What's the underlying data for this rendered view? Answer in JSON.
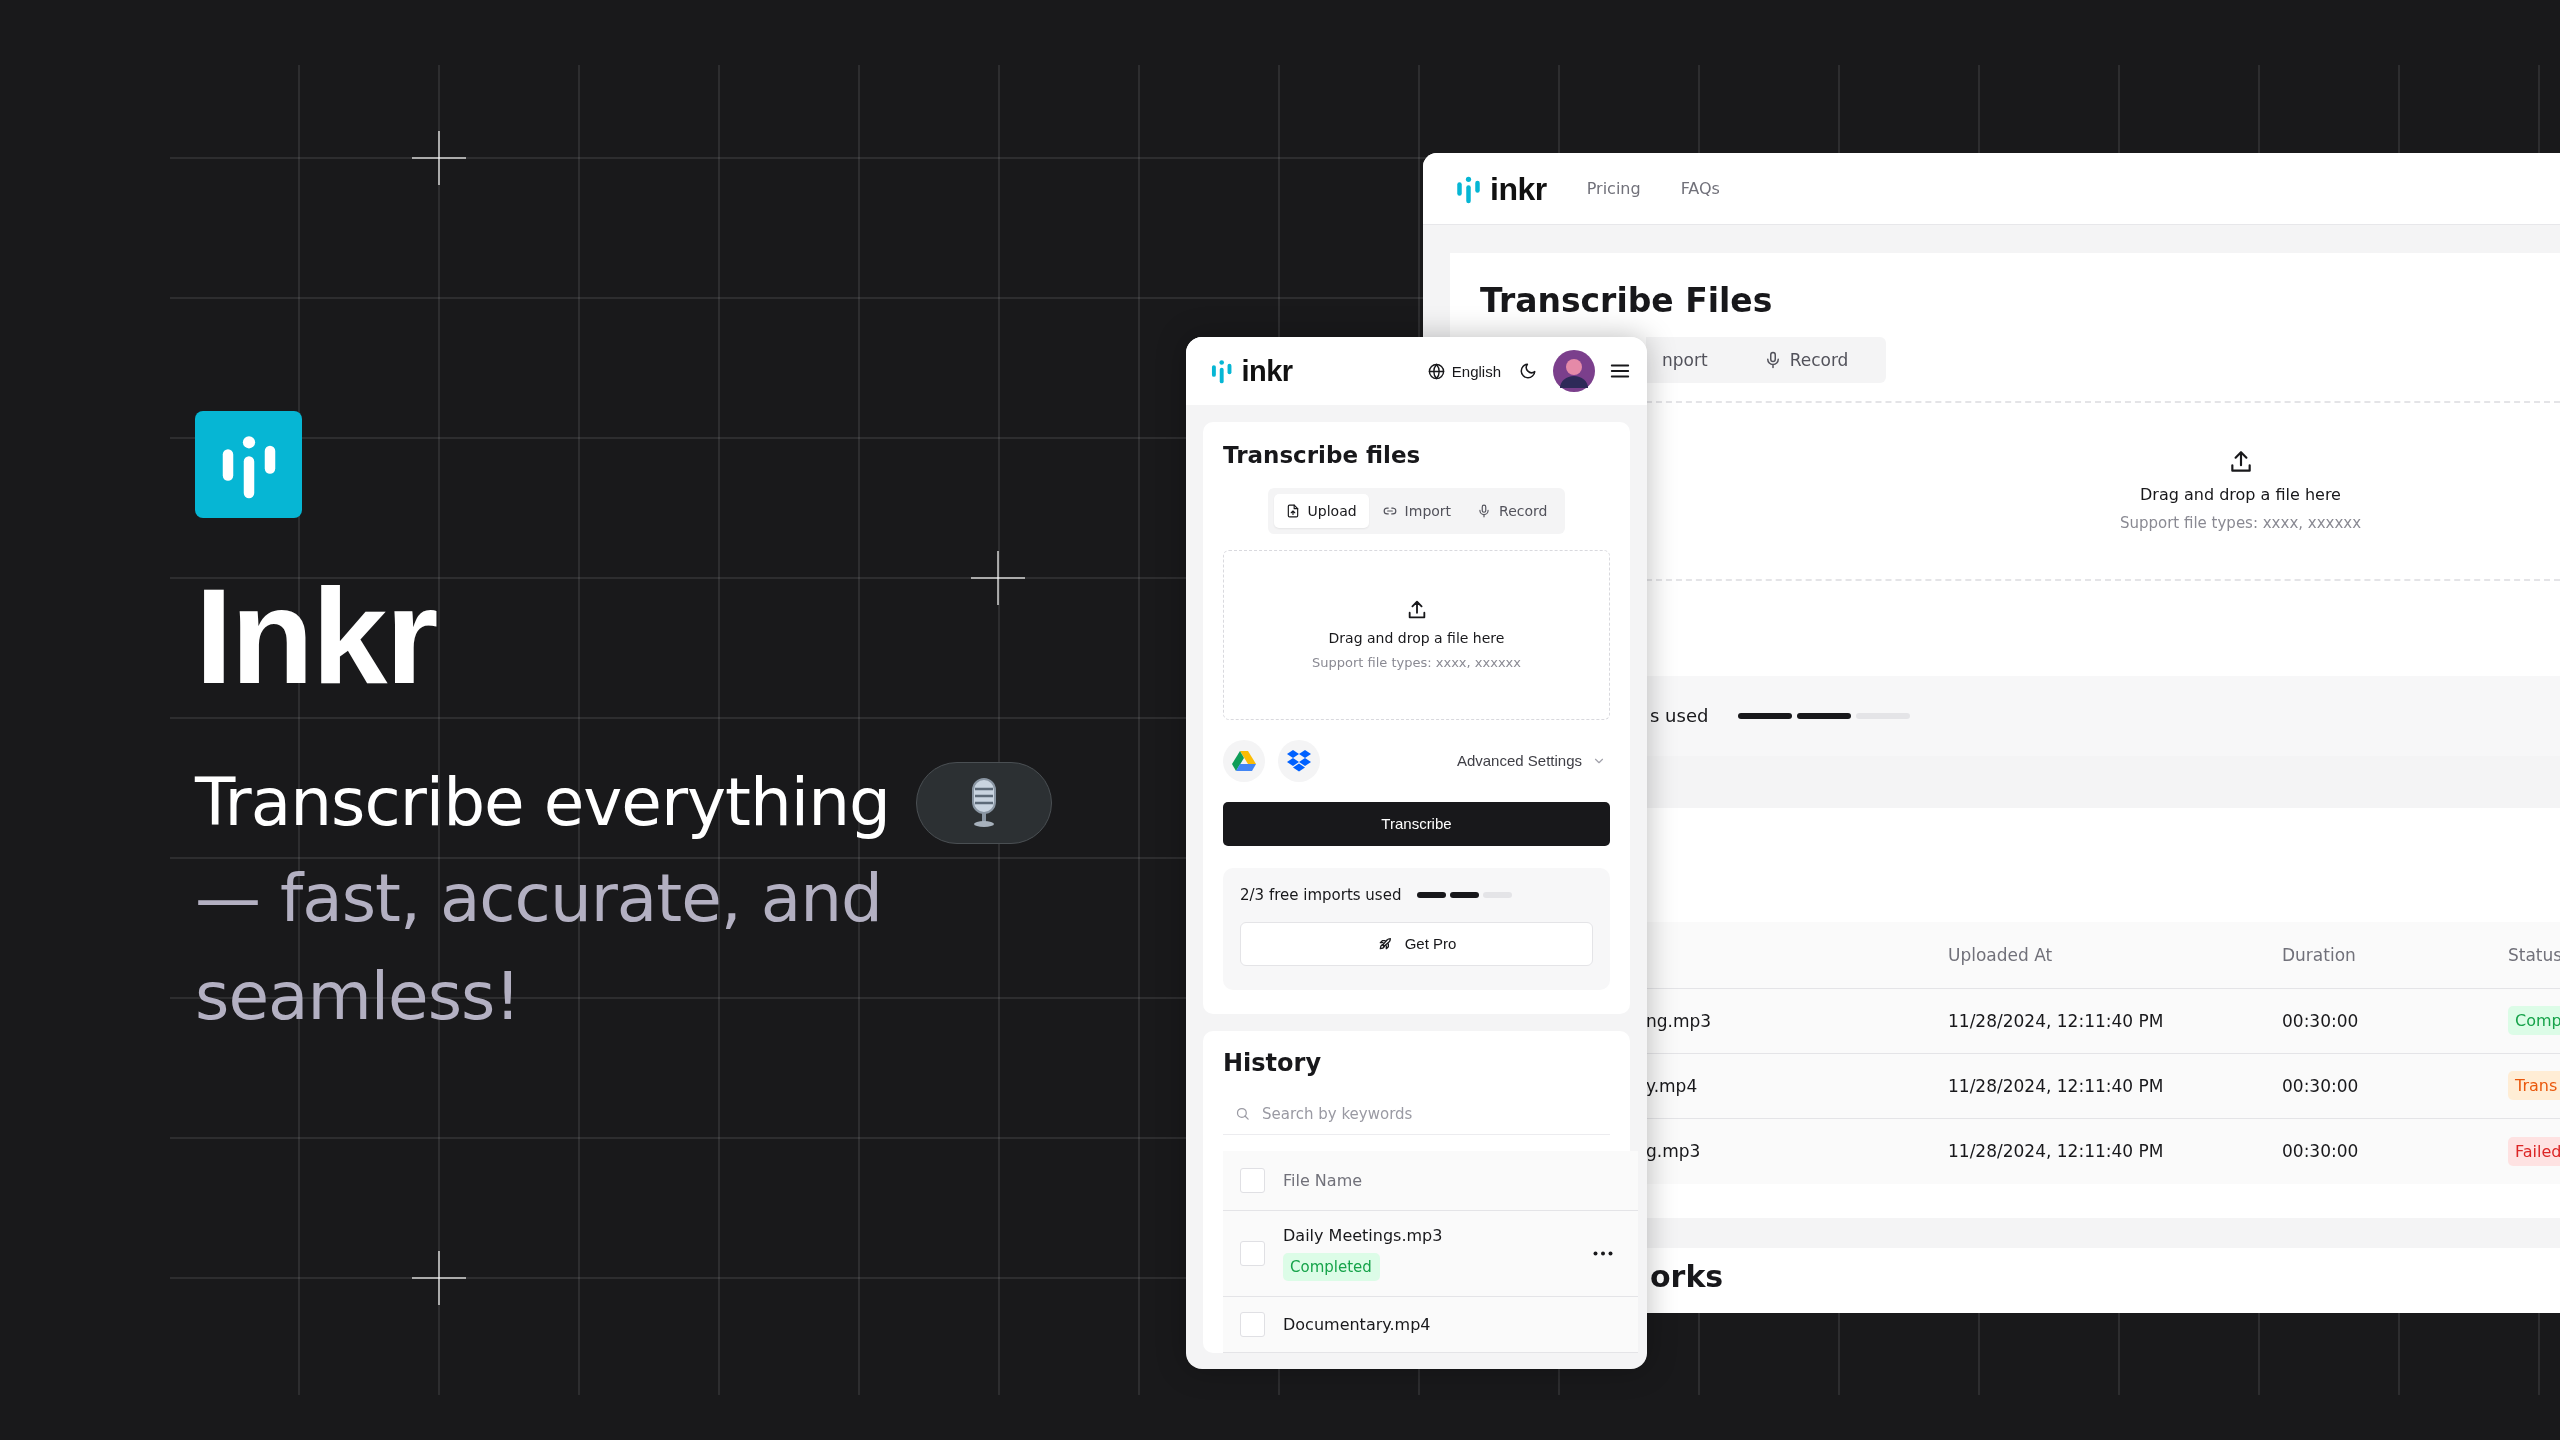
{
  "hero": {
    "title": "Inkr",
    "tagline": "Transcribe everything",
    "subtitle": "— fast, accurate, and seamless!"
  },
  "desktop": {
    "brand": "inkr",
    "nav": [
      "Pricing",
      "FAQs"
    ],
    "title": "Transcribe Files",
    "tabs": [
      {
        "label": "nport",
        "kind": "plain",
        "selected": false
      },
      {
        "label": "Record",
        "kind": "record",
        "selected": false
      }
    ],
    "dropzone": {
      "title": "Drag and drop a file here",
      "hint": "Support file types: xxxx, xxxxxx"
    },
    "usage": {
      "label": "s used",
      "level": 0.67
    },
    "table": {
      "columns": [
        "Uploaded At",
        "Duration",
        "Status"
      ],
      "rows": [
        {
          "file": "ng.mp3",
          "uploaded": "11/28/2024, 12:11:40 PM",
          "duration": "00:30:00",
          "status": {
            "label": "Comp",
            "kind": "completed"
          }
        },
        {
          "file": "y.mp4",
          "uploaded": "11/28/2024, 12:11:40 PM",
          "duration": "00:30:00",
          "status": {
            "label": "Trans",
            "kind": "transcribing"
          }
        },
        {
          "file": "g.mp3",
          "uploaded": "11/28/2024, 12:11:40 PM",
          "duration": "00:30:00",
          "status": {
            "label": "Failed",
            "kind": "failed"
          }
        }
      ]
    },
    "section_heading": "orks"
  },
  "mobile": {
    "brand": "inkr",
    "language": "English",
    "title": "Transcribe files",
    "tabs": [
      {
        "label": "Upload",
        "kind": "upload",
        "selected": true
      },
      {
        "label": "Import",
        "kind": "import",
        "selected": false
      },
      {
        "label": "Record",
        "kind": "record",
        "selected": false
      }
    ],
    "dropzone": {
      "title": "Drag and drop a file here",
      "hint": "Support file types: xxxx, xxxxxx"
    },
    "advanced": "Advanced Settings",
    "submit": "Transcribe",
    "usage": {
      "label": "2/3 free imports used",
      "level": 0.67
    },
    "upgrade": "Get Pro",
    "history": {
      "title": "History",
      "search": {
        "placeholder": "Search by keywords"
      },
      "header": {
        "label": "File Name",
        "checked": false
      },
      "rows": [
        {
          "file": "Daily Meetings.mp3",
          "checked": false,
          "status": {
            "label": "Completed",
            "kind": "completed"
          }
        },
        {
          "file": "Documentary.mp4",
          "checked": false
        }
      ]
    }
  }
}
